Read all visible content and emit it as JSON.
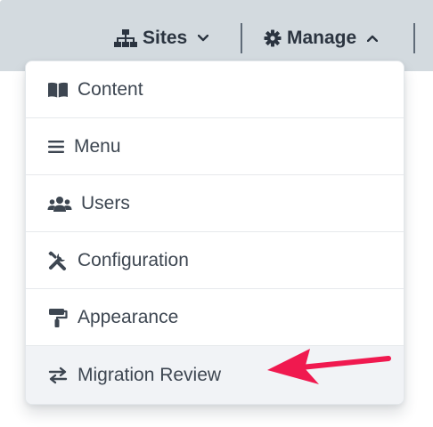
{
  "topbar": {
    "sites_label": "Sites",
    "manage_label": "Manage"
  },
  "manage_menu": {
    "items": [
      {
        "label": "Content",
        "icon": "book-open-icon"
      },
      {
        "label": "Menu",
        "icon": "bars-icon"
      },
      {
        "label": "Users",
        "icon": "users-icon"
      },
      {
        "label": "Configuration",
        "icon": "tools-icon"
      },
      {
        "label": "Appearance",
        "icon": "paint-roller-icon"
      },
      {
        "label": "Migration Review",
        "icon": "exchange-arrows-icon"
      }
    ],
    "highlighted_item": "Migration Review"
  },
  "colors": {
    "topbar_bg": "#d3dadf",
    "annotation_arrow": "#f0194f",
    "highlight_bg": "#f1f3f6"
  }
}
